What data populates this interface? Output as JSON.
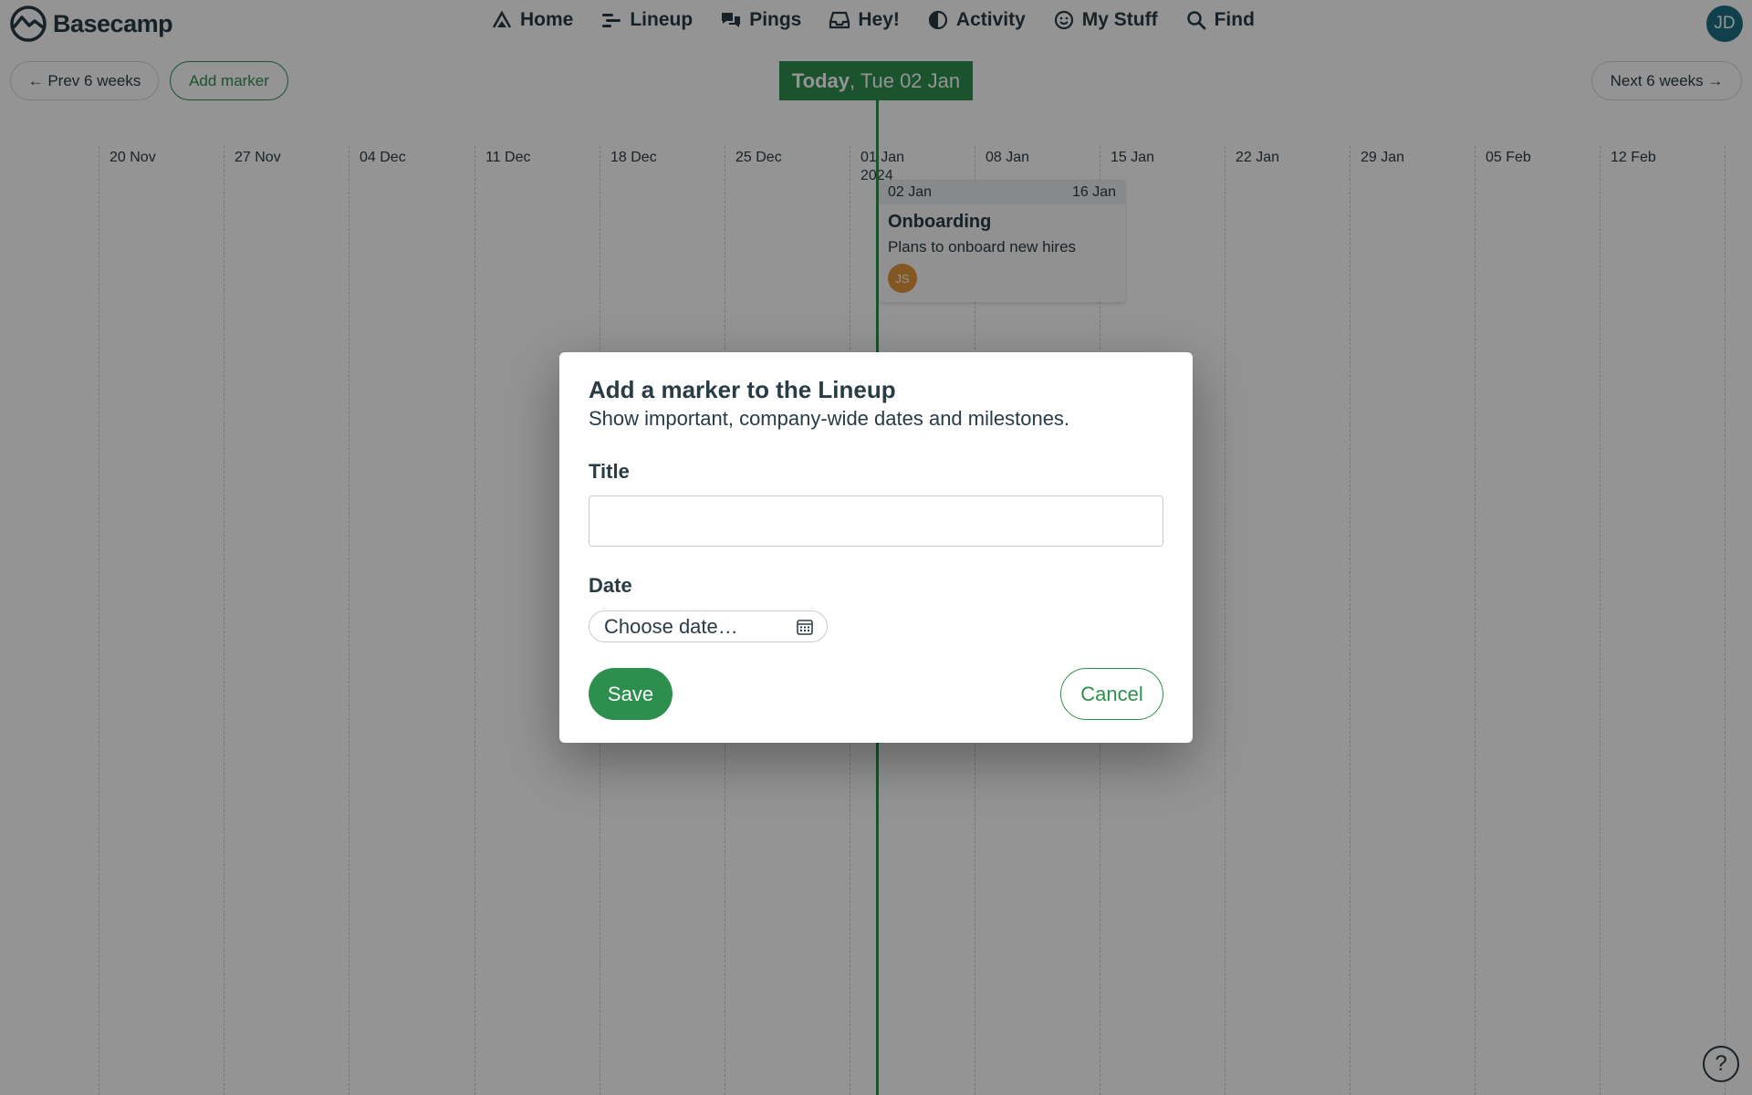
{
  "app": {
    "brand": "Basecamp"
  },
  "nav": {
    "items": [
      {
        "label": "Home",
        "icon": "home-icon"
      },
      {
        "label": "Lineup",
        "icon": "lineup-icon"
      },
      {
        "label": "Pings",
        "icon": "pings-icon"
      },
      {
        "label": "Hey!",
        "icon": "hey-inbox-icon"
      },
      {
        "label": "Activity",
        "icon": "activity-icon"
      },
      {
        "label": "My Stuff",
        "icon": "my-stuff-icon"
      },
      {
        "label": "Find",
        "icon": "search-icon"
      }
    ],
    "avatar_initials": "JD"
  },
  "toolbar": {
    "prev_label": "← Prev 6 weeks",
    "add_marker_label": "Add marker",
    "today_strong": "Today",
    "today_rest": ", Tue 02 Jan",
    "next_label": "Next 6 weeks →"
  },
  "timeline": {
    "weeks": [
      "20 Nov",
      "27 Nov",
      "04 Dec",
      "11 Dec",
      "18 Dec",
      "25 Dec",
      "01 Jan",
      "08 Jan",
      "15 Jan",
      "22 Jan",
      "29 Jan",
      "05 Feb",
      "12 Feb"
    ],
    "year_label": "2024",
    "event": {
      "start": "02 Jan",
      "end": "16 Jan",
      "title": "Onboarding",
      "description": "Plans to onboard new hires",
      "avatar_initials": "JS"
    }
  },
  "modal": {
    "title": "Add a marker to the Lineup",
    "subtitle": "Show important, company-wide dates and milestones.",
    "title_field_label": "Title",
    "title_value": "",
    "date_field_label": "Date",
    "date_placeholder": "Choose date…",
    "save_label": "Save",
    "cancel_label": "Cancel"
  },
  "help": {
    "label": "?"
  },
  "colors": {
    "accent": "#2d8f4e",
    "text": "#283c46",
    "avatar_jd": "#1a6e84",
    "avatar_js": "#e0963c"
  }
}
